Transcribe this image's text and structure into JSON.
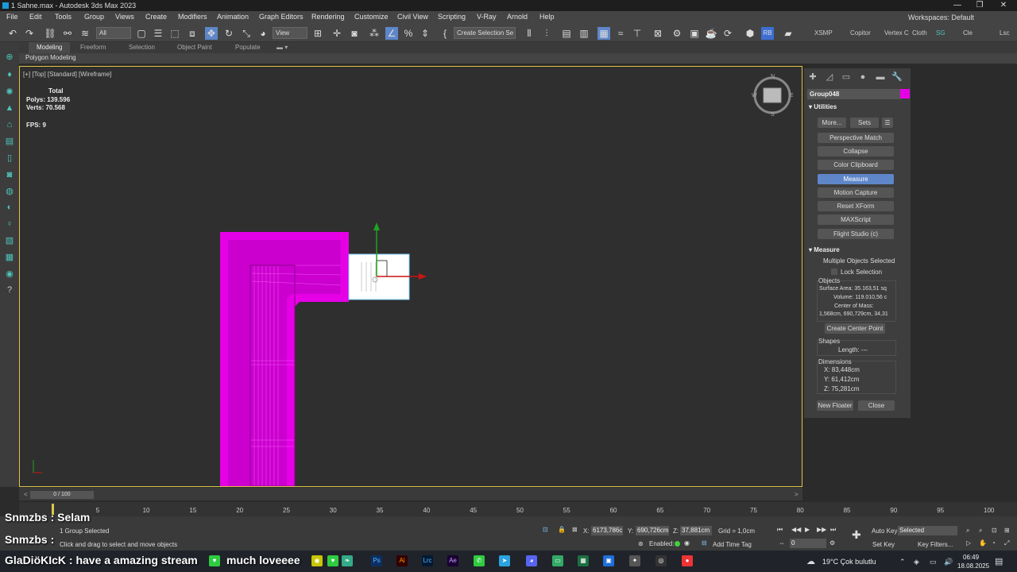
{
  "window": {
    "title": "1 Sahne.max - Autodesk 3ds Max 2023",
    "min": "—",
    "max": "❐",
    "close": "✕"
  },
  "menu": [
    "File",
    "Edit",
    "Tools",
    "Group",
    "Views",
    "Create",
    "Modifiers",
    "Animation",
    "Graph Editors",
    "Rendering",
    "Customize",
    "Civil View",
    "Scripting",
    "V-Ray",
    "Arnold",
    "Help"
  ],
  "workspace": "Workspaces: Default",
  "toolbar": {
    "filter": "All",
    "ref_coord": "View",
    "selection_set": "Create Selection Se",
    "xsmp": "XSMP",
    "copitor": "Copitor",
    "vertex": "Vertex C",
    "cloth": "Cloth",
    "sg": "SG",
    "cle": "Cle",
    "last": "Lsc"
  },
  "ribbon": {
    "tabs": [
      "Modeling",
      "Freeform",
      "Selection",
      "Object Paint",
      "Populate"
    ],
    "sub": "Polygon Modeling"
  },
  "viewport": {
    "label": "[+] [Top] [Standard] [Wireframe]",
    "stats_total": "Total",
    "polys": "Polys:  139.596",
    "verts": "Verts:  70.568",
    "fps": "FPS:     9"
  },
  "command_panel": {
    "object_name": "Group048",
    "object_color": "#e600e6",
    "utilities_header": "Utilities",
    "more": "More...",
    "sets": "Sets",
    "buttons": [
      "Perspective Match",
      "Collapse",
      "Color Clipboard",
      "Measure",
      "Motion Capture",
      "Reset XForm",
      "MAXScript",
      "Flight Studio (c)"
    ],
    "active_button": "Measure",
    "measure_header": "Measure",
    "multiple": "Multiple Objects Selected",
    "lock": "Lock Selection",
    "objects_label": "Objects",
    "surface_area": "Surface Area:  35.163,51 sq",
    "volume": "Volume:  119.010,56 c",
    "center_mass": "Center of Mass:",
    "center_vals": "1,568cm, 690,729cm, 34,31",
    "create_center": "Create Center Point",
    "shapes_label": "Shapes",
    "length": "Length:  ---",
    "dimensions_label": "Dimensions",
    "dim_x": "X:  83,448cm",
    "dim_y": "Y:  61,412cm",
    "dim_z": "Z:  75,281cm",
    "new_floater": "New Floater",
    "close": "Close"
  },
  "timeline": {
    "slider": "0 / 100",
    "ticks": [
      "0",
      "5",
      "10",
      "15",
      "20",
      "25",
      "30",
      "35",
      "40",
      "45",
      "50",
      "55",
      "60",
      "65",
      "70",
      "75",
      "80",
      "85",
      "90",
      "95",
      "100"
    ]
  },
  "status": {
    "selected": "1 Group Selected",
    "prompt": "Click and drag to select and move objects",
    "x": "6173,786c",
    "y": "690,726cm",
    "z": "37,881cm",
    "grid": "Grid = 1,0cm",
    "enabled": "Enabled:",
    "add_time_tag": "Add Time Tag",
    "auto_key": "Auto Key",
    "selected_drop": "Selected",
    "set_key": "Set Key",
    "key_filters": "Key Filters...",
    "frame": "0"
  },
  "chat": [
    {
      "user": "Snmzbs",
      "msg": ": Selam"
    },
    {
      "user": "Snmzbs",
      "msg": ": "
    },
    {
      "user": "GlaDiöKIcK",
      "msg": ": have a amazing stream"
    },
    {
      "user": "",
      "msg": "much loveeee"
    }
  ],
  "taskbar": {
    "weather": "19°C  Çok bulutlu",
    "time": "06:49",
    "date": "18.08.2025"
  }
}
